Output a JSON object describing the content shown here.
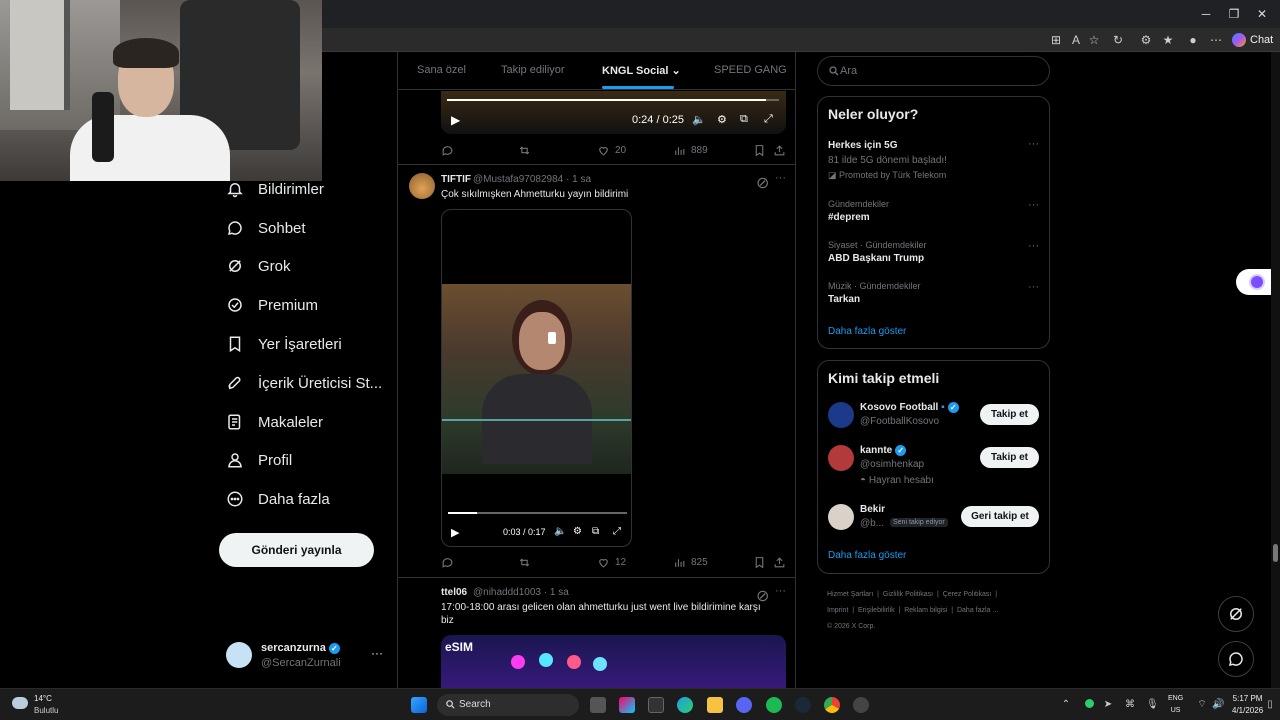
{
  "tabs": [
    "Sana özel",
    "Takip ediliyor",
    "KNGL Social",
    "SPEED GANG"
  ],
  "nav": {
    "items": [
      "Bildirimler",
      "Sohbet",
      "Grok",
      "Premium",
      "Yer İşaretleri",
      "İçerik Üreticisi St...",
      "Makaleler",
      "Profil",
      "Daha fazla"
    ],
    "post_button": "Gönderi yayınla"
  },
  "account": {
    "name": "sercanzurna",
    "handle": "@SercanZurnali"
  },
  "tweets": [
    {
      "video_time": "0:24 / 0:25",
      "video_progress": 0.96,
      "actions": {
        "replies": "",
        "reposts": "",
        "likes": "20",
        "views": "889"
      }
    },
    {
      "name": "TIFTIF",
      "handle": "@Mustafa97082984 · 1 sa",
      "text": "Çok sıkılmışken Ahmetturku yayın bildirimi",
      "video_time": "0:03 / 0:17",
      "video_progress": 0.16,
      "actions": {
        "replies": "",
        "reposts": "",
        "likes": "12",
        "views": "825"
      }
    },
    {
      "name": "ttel06",
      "handle": "@nihaddd1003 · 1 sa",
      "text": "17:00-18:00 arası gelicen olan ahmetturku just went live bildirimine karşı biz",
      "media_label": "eSIM"
    }
  ],
  "search": {
    "placeholder": "Ara"
  },
  "trends": {
    "title": "Neler oluyor?",
    "items": [
      {
        "category": "",
        "name": "Herkes için 5G",
        "sub": "81 ilde 5G dönemi başladı!",
        "promo": "Promoted by Türk Telekom"
      },
      {
        "category": "Gündemdekiler",
        "name": "#deprem"
      },
      {
        "category": "Siyaset · Gündemdekiler",
        "name": "ABD Başkanı Trump"
      },
      {
        "category": "Müzik · Gündemdekiler",
        "name": "Tarkan"
      }
    ],
    "show_more": "Daha fazla göster"
  },
  "who_to_follow": {
    "title": "Kimi takip etmeli",
    "items": [
      {
        "name": "Kosovo Football",
        "handle": "@FootballKosovo",
        "button": "Takip et"
      },
      {
        "name": "kannte",
        "handle": "@osimhenkap",
        "note": "Hayran hesabı",
        "button": "Takip et"
      },
      {
        "name": "Bekir",
        "handle": "@b...",
        "badge": "Seni takip ediyor",
        "button": "Geri takip et"
      }
    ],
    "show_more": "Daha fazla göster"
  },
  "footer": {
    "links": [
      "Hizmet Şartları",
      "Gizlilik Politikası",
      "Çerez Politikası",
      "Imprint",
      "Erişilebilirlik",
      "Reklam bilgisi",
      "Daha fazla ..."
    ],
    "copyright": "© 2026 X Corp."
  },
  "browser": {
    "chat_label": "Chat"
  },
  "taskbar": {
    "weather_temp": "14°C",
    "weather_desc": "Bulutlu",
    "search_label": "Search",
    "lang_line1": "ENG",
    "lang_line2": "US",
    "time": "5:17 PM",
    "date": "4/1/2026"
  },
  "colors": {
    "accent": "#1d9bf0",
    "background": "#000000",
    "muted": "#71767b"
  }
}
